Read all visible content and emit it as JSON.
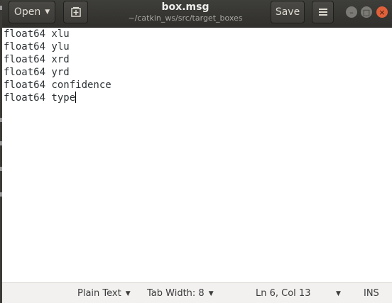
{
  "window": {
    "title": "box.msg",
    "subtitle": "~/catkin_ws/src/target_boxes"
  },
  "header": {
    "open_label": "Open",
    "open_caret_icon": "caret-down-icon",
    "new_tab_icon": "new-document-icon",
    "save_label": "Save",
    "menu_icon": "hamburger-menu-icon",
    "minimize_glyph": "–",
    "maximize_glyph": "□",
    "close_glyph": "×"
  },
  "editor": {
    "lines": [
      "float64 xlu",
      "float64 ylu",
      "float64 xrd",
      "float64 yrd",
      "float64 confidence",
      "float64 type"
    ]
  },
  "statusbar": {
    "language": "Plain Text",
    "tab_width": "Tab Width: 8",
    "position": "Ln 6, Col 13",
    "mode": "INS"
  },
  "colors": {
    "headerbar": "#3c3b37",
    "close_button": "#e0603a",
    "editor_background": "#ffffff",
    "statusbar": "#f2f1f0"
  }
}
